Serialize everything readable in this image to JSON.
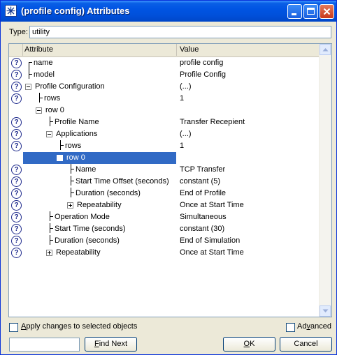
{
  "window": {
    "title": "(profile config) Attributes",
    "icon": "star-icon",
    "controls": [
      "minimize-icon",
      "maximize-icon",
      "close-icon"
    ]
  },
  "type_field": {
    "label": "Type:",
    "value": "utility"
  },
  "grid": {
    "columns": [
      "Attribute",
      "Value"
    ],
    "help_glyph": "?",
    "rows": [
      {
        "attr": "name",
        "value": "profile config",
        "level": 0,
        "help": true
      },
      {
        "attr": "model",
        "value": "Profile Config",
        "level": 0,
        "help": true
      },
      {
        "attr": "Profile Configuration",
        "value": "(...)",
        "level": 0,
        "help": true,
        "expander": "minus"
      },
      {
        "attr": "rows",
        "value": "1",
        "level": 1,
        "help": true
      },
      {
        "attr": "row 0",
        "value": "",
        "level": 1,
        "help": false,
        "expander": "minus"
      },
      {
        "attr": "Profile Name",
        "value": "Transfer Recepient",
        "level": 2,
        "help": true
      },
      {
        "attr": "Applications",
        "value": "(...)",
        "level": 2,
        "help": true,
        "expander": "minus"
      },
      {
        "attr": "rows",
        "value": "1",
        "level": 3,
        "help": true
      },
      {
        "attr": "row 0",
        "value": "",
        "level": 3,
        "help": false,
        "expander": "minus",
        "selected": true
      },
      {
        "attr": "Name",
        "value": "TCP Transfer",
        "level": 4,
        "help": true
      },
      {
        "attr": "Start Time Offset (seconds)",
        "value": "constant (5)",
        "level": 4,
        "help": true
      },
      {
        "attr": "Duration (seconds)",
        "value": "End of Profile",
        "level": 4,
        "help": true
      },
      {
        "attr": "Repeatability",
        "value": "Once at Start Time",
        "level": 4,
        "help": true,
        "expander": "plus"
      },
      {
        "attr": "Operation Mode",
        "value": "Simultaneous",
        "level": 2,
        "help": true
      },
      {
        "attr": "Start Time (seconds)",
        "value": "constant (30)",
        "level": 2,
        "help": true
      },
      {
        "attr": "Duration (seconds)",
        "value": "End of Simulation",
        "level": 2,
        "help": true
      },
      {
        "attr": "Repeatability",
        "value": "Once at Start Time",
        "level": 2,
        "help": true,
        "expander": "plus"
      }
    ]
  },
  "footer": {
    "apply_label": "Apply changes to selected objects",
    "advanced_label": "Advanced",
    "find_value": "",
    "find_next_label": "Find Next",
    "ok_label": "OK",
    "cancel_label": "Cancel"
  }
}
